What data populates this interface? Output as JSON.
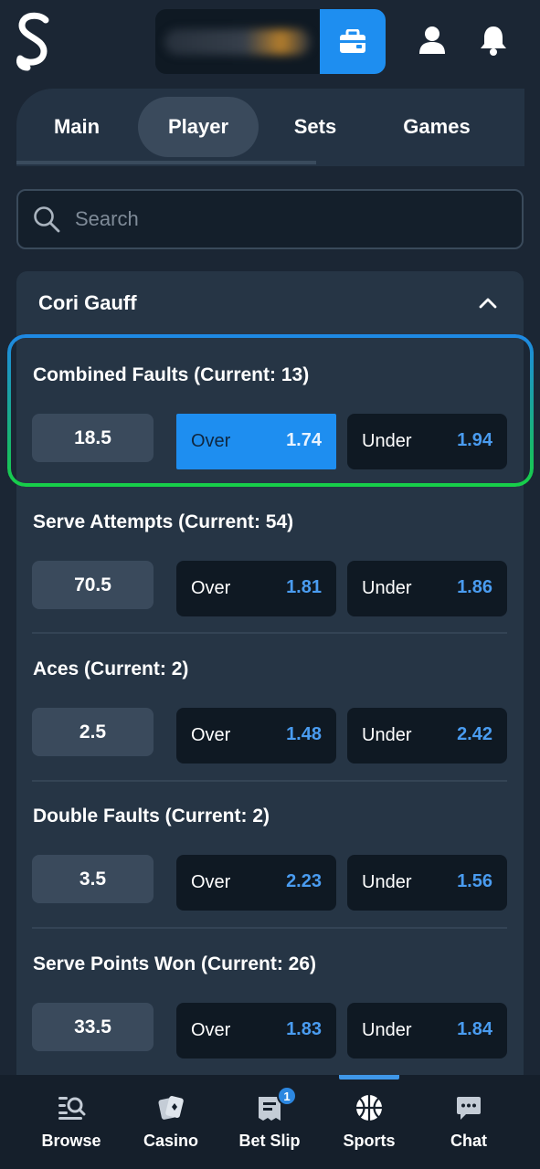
{
  "header": {
    "logo_icon": "stake-s-logo-icon",
    "wallet_icon": "wallet-icon",
    "profile_icon": "user-icon",
    "notifications_icon": "bell-icon",
    "accent_color": "#1e8ef0"
  },
  "tabs": [
    {
      "label": "Main",
      "active": false
    },
    {
      "label": "Player",
      "active": true
    },
    {
      "label": "Sets",
      "active": false
    },
    {
      "label": "Games",
      "active": false
    }
  ],
  "search": {
    "placeholder": "Search",
    "value": ""
  },
  "player_section": {
    "name": "Cori Gauff",
    "expanded": true,
    "markets": [
      {
        "title": "Combined Faults (Current: 13)",
        "line": "18.5",
        "over_label": "Over",
        "over_odds": "1.74",
        "under_label": "Under",
        "under_odds": "1.94",
        "selected": "over"
      },
      {
        "title": "Serve Attempts (Current: 54)",
        "line": "70.5",
        "over_label": "Over",
        "over_odds": "1.81",
        "under_label": "Under",
        "under_odds": "1.86",
        "selected": null
      },
      {
        "title": "Aces (Current: 2)",
        "line": "2.5",
        "over_label": "Over",
        "over_odds": "1.48",
        "under_label": "Under",
        "under_odds": "2.42",
        "selected": null
      },
      {
        "title": "Double Faults (Current: 2)",
        "line": "3.5",
        "over_label": "Over",
        "over_odds": "2.23",
        "under_label": "Under",
        "under_odds": "1.56",
        "selected": null
      },
      {
        "title": "Serve Points Won (Current: 26)",
        "line": "33.5",
        "over_label": "Over",
        "over_odds": "1.83",
        "under_label": "Under",
        "under_odds": "1.84",
        "selected": null
      }
    ]
  },
  "bottom_nav": [
    {
      "label": "Browse",
      "icon": "browse-icon",
      "active": false
    },
    {
      "label": "Casino",
      "icon": "cards-icon",
      "active": false
    },
    {
      "label": "Bet Slip",
      "icon": "bet-slip-icon",
      "active": false,
      "badge": "1"
    },
    {
      "label": "Sports",
      "icon": "basketball-icon",
      "active": true
    },
    {
      "label": "Chat",
      "icon": "chat-icon",
      "active": false
    }
  ]
}
